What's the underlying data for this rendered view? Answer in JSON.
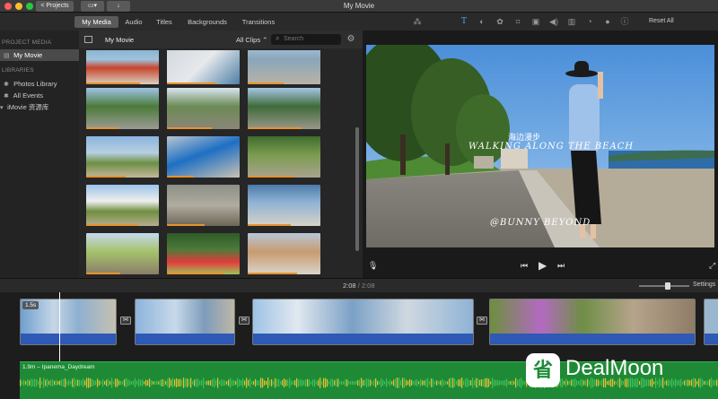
{
  "window": {
    "title": "My Movie",
    "projects_button": "< Projects"
  },
  "tabs": [
    {
      "label": "My Media",
      "active": true
    },
    {
      "label": "Audio"
    },
    {
      "label": "Titles"
    },
    {
      "label": "Backgrounds"
    },
    {
      "label": "Transitions"
    }
  ],
  "toolbar": {
    "reset_all": "Reset All",
    "tools": [
      "magic-wand-icon",
      "title-icon",
      "color-balance-icon",
      "color-correction-icon",
      "crop-icon",
      "stabilization-icon",
      "volume-icon",
      "noise-reduction-icon",
      "speed-icon",
      "filter-icon",
      "info-icon"
    ]
  },
  "sidebar": {
    "project_media_header": "PROJECT MEDIA",
    "project_item": "My Movie",
    "libraries_header": "LIBRARIES",
    "items": [
      {
        "label": "Photos Library",
        "icon": "photos-icon"
      },
      {
        "label": "All Events",
        "icon": "star-icon"
      },
      {
        "label": "iMovie 资源库",
        "icon": "disclosure-triangle-icon"
      }
    ]
  },
  "browser": {
    "title": "My Movie",
    "filter": "All Clips",
    "search_placeholder": "Search"
  },
  "viewer": {
    "overlay_line1": "海边漫步",
    "overlay_line2": "WALKING ALONG THE BEACH",
    "overlay_line3": "@BUNNY BEYOND"
  },
  "timeline": {
    "timecode_current": "2:08",
    "timecode_total": "2:08",
    "timecode_separator": "/",
    "settings_label": "Settings",
    "clip_duration": "1.5s",
    "music_label": "1.9m – Ipanema_Daydream"
  },
  "watermark": {
    "text": "DealMoon"
  },
  "colors": {
    "accent_orange": "#e7922d",
    "audio_blue": "#2e59b4",
    "music_green": "#1f8a36"
  }
}
